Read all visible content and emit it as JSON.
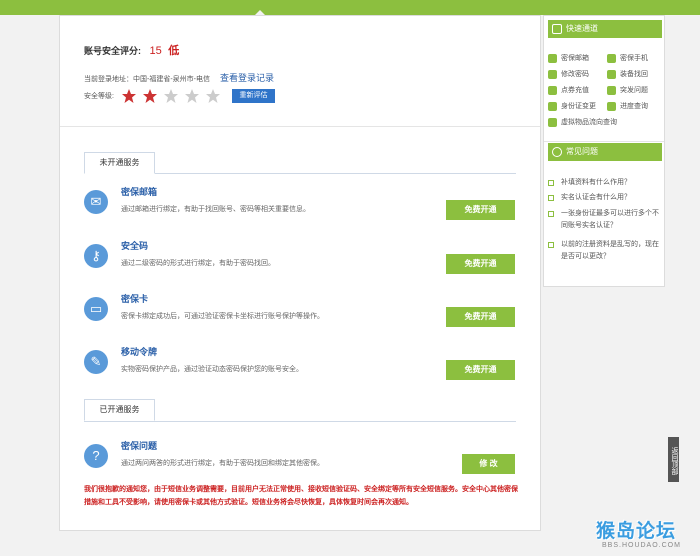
{
  "header": {
    "score_label": "账号安全评分:",
    "score_value": "15",
    "score_level": "低",
    "login_label": "当前登录地址：",
    "login_location": "中国-福建省-泉州市-电信",
    "login_record_link": "查看登录记录",
    "level_label": "安全等级:",
    "stars_filled": 2,
    "stars_total": 5,
    "reassess_button": "重新评估"
  },
  "tabs": {
    "unopened": "未开通服务",
    "opened": "已开通服务"
  },
  "services": [
    {
      "icon": "envelope-icon",
      "title": "密保邮箱",
      "desc": "通过邮箱进行绑定，有助于找回账号、密码等相关重要信息。",
      "button": "免费开通"
    },
    {
      "icon": "key-icon",
      "title": "安全码",
      "desc": "通过二级密码的形式进行绑定，有助于密码找回。",
      "button": "免费开通"
    },
    {
      "icon": "card-icon",
      "title": "密保卡",
      "desc": "密保卡绑定成功后，可通过验证密保卡坐标进行账号保护等操作。",
      "button": "免费开通"
    },
    {
      "icon": "token-icon",
      "title": "移动令牌",
      "desc": "实物密码保护产品，通过验证动态密码保护您的账号安全。",
      "button": "免费开通"
    }
  ],
  "opened_services": [
    {
      "icon": "question-lock-icon",
      "title": "密保问题",
      "desc": "通过两问两答的形式进行绑定，有助于密码找回和绑定其他密保。",
      "button": "修 改"
    }
  ],
  "notice": "我们很抱歉的通知您，由于短信业务调整需要，目前用户无法正常使用、接收短信验证码、安全绑定等所有安全短信服务。安全中心其他密保措施和工具不受影响，请使用密保卡或其他方式验证。短信业务将会尽快恢复，具体恢复时间会再次通知。",
  "sidebar": {
    "quick_title": "快速通道",
    "quick_links": [
      {
        "label": "密保邮箱",
        "icon": "mail-icon"
      },
      {
        "label": "密保手机",
        "icon": "phone-icon"
      },
      {
        "label": "修改密码",
        "icon": "edit-icon"
      },
      {
        "label": "装备找回",
        "icon": "recover-icon"
      },
      {
        "label": "点券充值",
        "icon": "coupon-icon"
      },
      {
        "label": "突发问题",
        "icon": "help-icon"
      },
      {
        "label": "身份证变更",
        "icon": "idcard-icon"
      },
      {
        "label": "进度查询",
        "icon": "progress-icon"
      },
      {
        "label": "虚拟物品流向查询",
        "icon": "gift-icon"
      }
    ],
    "faq_title": "常见问题",
    "faq": [
      "补填资料有什么作用？",
      "实名认证会有什么用？",
      "一张身份证最多可以进行多个不同账号实名认证？",
      "以前的注册资料是乱写的，现在是否可以更改？"
    ]
  },
  "back_to_top": "返回顶部",
  "watermark": {
    "logo": "猴岛论坛",
    "url": "BBS.HOUDAO.COM"
  },
  "colors": {
    "green": "#8cbf3f",
    "blue": "#2a5fa8",
    "red": "#cc2222",
    "star": "#cc3333"
  }
}
